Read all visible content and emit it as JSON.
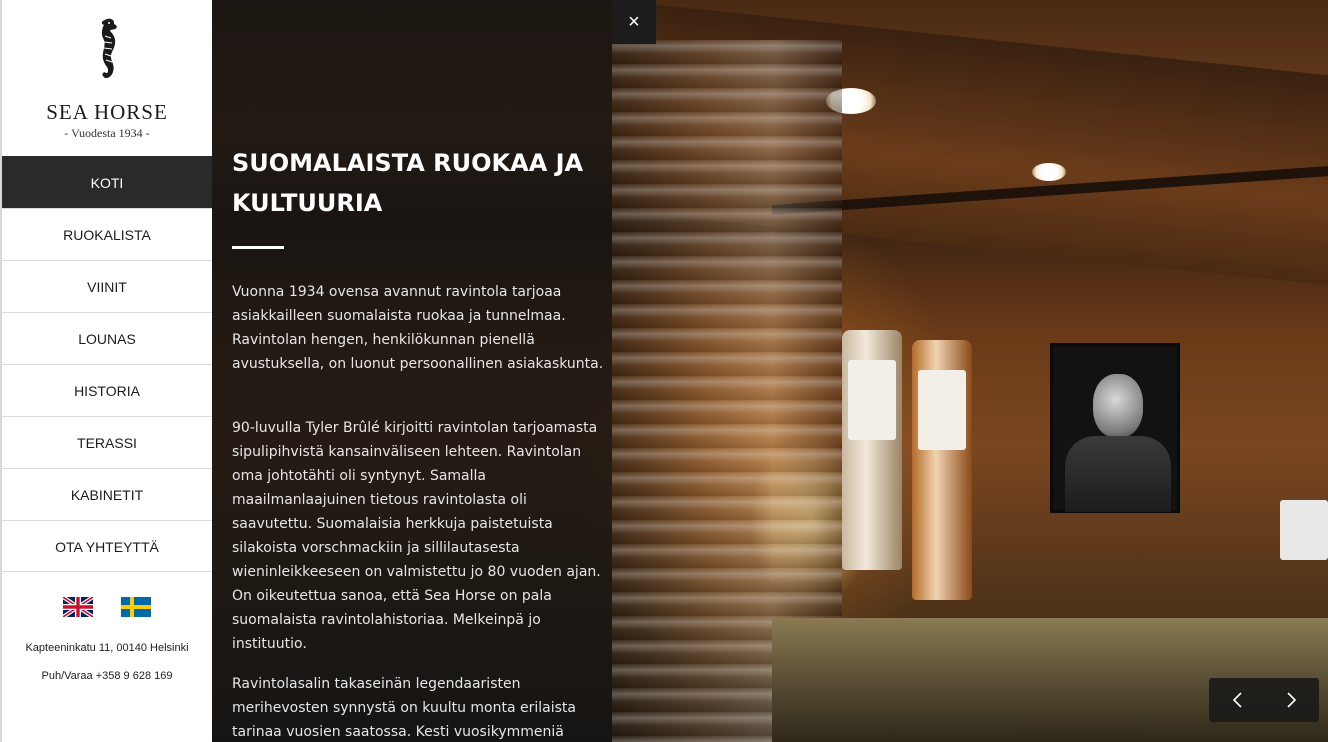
{
  "brand": {
    "name": "SEA HORSE",
    "tagline": "- Vuodesta 1934 -",
    "logo_icon": "seahorse-icon"
  },
  "nav": {
    "items": [
      {
        "label": "KOTI",
        "active": true
      },
      {
        "label": "RUOKALISTA",
        "active": false
      },
      {
        "label": "VIINIT",
        "active": false
      },
      {
        "label": "LOUNAS",
        "active": false
      },
      {
        "label": "HISTORIA",
        "active": false
      },
      {
        "label": "TERASSI",
        "active": false
      },
      {
        "label": "KABINETIT",
        "active": false
      },
      {
        "label": "OTA YHTEYTTÄ",
        "active": false
      }
    ]
  },
  "languages": [
    {
      "name": "english-flag-icon"
    },
    {
      "name": "swedish-flag-icon"
    }
  ],
  "contact": {
    "address": "Kapteeninkatu 11, 00140 Helsinki",
    "phone": "Puh/Varaa +358 9 628 169"
  },
  "panel": {
    "title": "SUOMALAISTA RUOKAA JA KULTUURIA",
    "paragraphs": [
      "Vuonna 1934 ovensa avannut ravintola tarjoaa asiakkailleen suomalaista ruokaa ja tunnelmaa. Ravintolan hengen, henkilökunnan pienellä avustuksella, on luonut persoonallinen asiakaskunta.",
      "90-luvulla Tyler Brûlé kirjoitti ravintolan tarjoamasta sipulipihvistä kansainväliseen lehteen. Ravintolan oma johtotähti oli syntynyt. Samalla maailmanlaajuinen tietous ravintolasta oli saavutettu. Suomalaisia herkkuja paistetuista silakoista vorschmackiin ja sillilautasesta wieninleikkeeseen on valmistettu jo 80 vuoden ajan. On oikeutettua sanoa, että Sea Horse on pala suomalaista ravintolahistoriaa. Melkeinpä jo instituutio.",
      "Ravintolasalin takaseinän legendaaristen merihevosten synnystä on kuultu monta erilaista tarinaa vuosien saatossa. Kesti vuosikymmeniä ennen"
    ]
  },
  "close": {
    "label": "×",
    "icon": "close-icon"
  },
  "slider": {
    "prev_icon": "chevron-left-icon",
    "next_icon": "chevron-right-icon"
  },
  "colors": {
    "sidebar_bg": "#ffffff",
    "nav_active_bg": "#2a2a2a",
    "panel_bg": "#121212"
  }
}
